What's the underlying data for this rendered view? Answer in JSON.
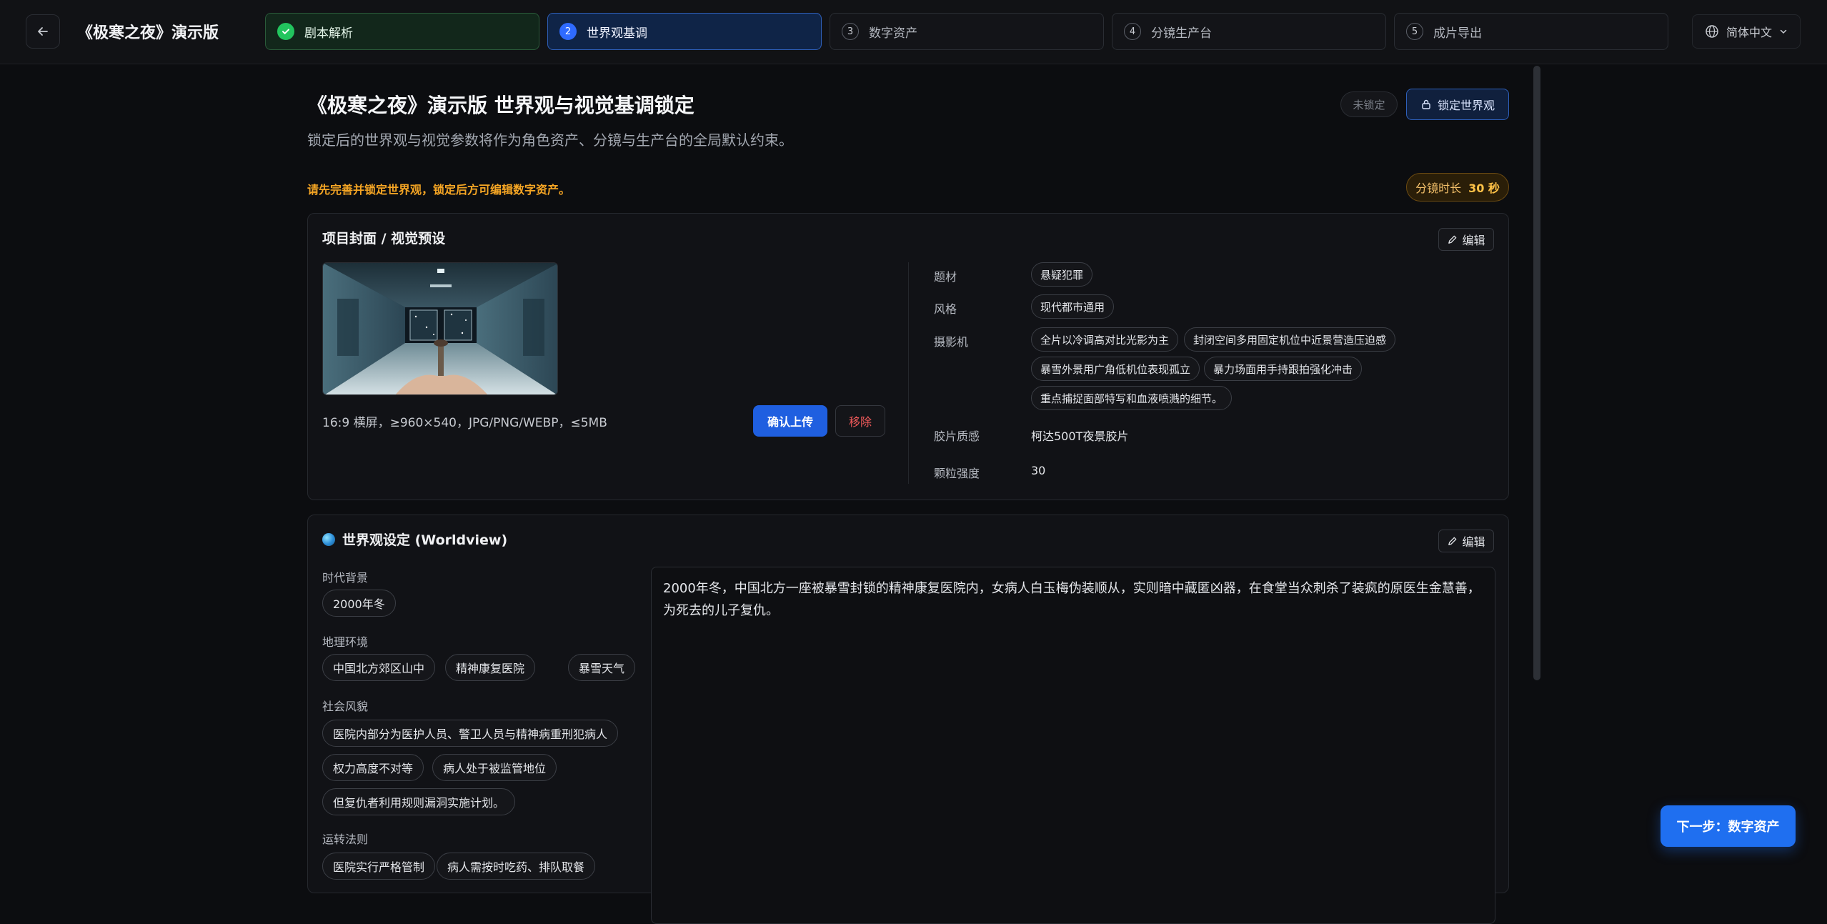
{
  "header": {
    "title": "《极寒之夜》演示版",
    "language": "简体中文"
  },
  "steps": [
    {
      "num": "1",
      "label": "剧本解析",
      "state": "done"
    },
    {
      "num": "2",
      "label": "世界观基调",
      "state": "active"
    },
    {
      "num": "3",
      "label": "数字资产",
      "state": "todo"
    },
    {
      "num": "4",
      "label": "分镜生产台",
      "state": "todo"
    },
    {
      "num": "5",
      "label": "成片导出",
      "state": "todo"
    }
  ],
  "page": {
    "title": "《极寒之夜》演示版 世界观与视觉基调锁定",
    "subtitle": "锁定后的世界观与视觉参数将作为角色资产、分镜与生产台的全局默认约束。",
    "status": "未锁定",
    "lock_label": "锁定世界观",
    "warning": "请先完善并锁定世界观，锁定后方可编辑数字资产。",
    "duration_label": "分镜时长",
    "duration_value": "30 秒"
  },
  "cover_card": {
    "title": "项目封面 / 视觉预设",
    "edit_label": "编辑",
    "hint": "16:9 横屏，≥960×540，JPG/PNG/WEBP，≤5MB",
    "confirm_label": "确认上传",
    "remove_label": "移除",
    "genre_label": "题材",
    "genre": "悬疑犯罪",
    "style_label": "风格",
    "style": "现代都市通用",
    "camera_label": "摄影机",
    "camera": [
      "全片以冷调高对比光影为主",
      "封闭空间多用固定机位中近景营造压迫感",
      "暴雪外景用广角低机位表现孤立",
      "暴力场面用手持跟拍强化冲击",
      "重点捕捉面部特写和血液喷溅的细节。"
    ],
    "film_label": "胶片质感",
    "film": "柯达500T夜景胶片",
    "grain_label": "颗粒强度",
    "grain": "30"
  },
  "worldview_card": {
    "title": "世界观设定 (Worldview)",
    "edit_label": "编辑",
    "era_label": "时代背景",
    "era": [
      "2000年冬"
    ],
    "geo_label": "地理环境",
    "geo": [
      "中国北方郊区山中",
      "精神康复医院",
      "暴雪天气"
    ],
    "society_label": "社会风貌",
    "society": [
      "医院内部分为医护人员、警卫人员与精神病重刑犯病人",
      "权力高度不对等",
      "病人处于被监管地位",
      "但复仇者利用规则漏洞实施计划。"
    ],
    "rules_label": "运转法则",
    "rules": [
      "医院实行严格管制",
      "病人需按时吃药、排队取餐"
    ],
    "description": "2000年冬，中国北方一座被暴雪封锁的精神康复医院内，女病人白玉梅伪装顺从，实则暗中藏匿凶器，在食堂当众刺杀了装疯的原医生金慧善，为死去的儿子复仇。"
  },
  "footer": {
    "next_label": "下一步：数字资产"
  }
}
